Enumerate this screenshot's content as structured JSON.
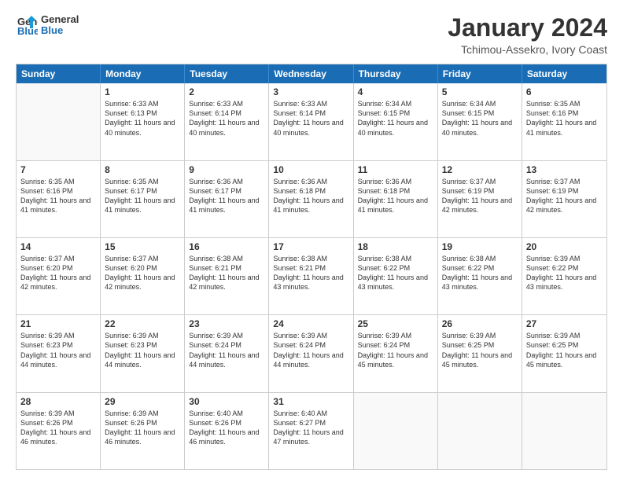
{
  "logo": {
    "line1": "General",
    "line2": "Blue"
  },
  "title": "January 2024",
  "location": "Tchimou-Assekro, Ivory Coast",
  "header_days": [
    "Sunday",
    "Monday",
    "Tuesday",
    "Wednesday",
    "Thursday",
    "Friday",
    "Saturday"
  ],
  "rows": [
    [
      {
        "day": "",
        "sunrise": "",
        "sunset": "",
        "daylight": ""
      },
      {
        "day": "1",
        "sunrise": "Sunrise: 6:33 AM",
        "sunset": "Sunset: 6:13 PM",
        "daylight": "Daylight: 11 hours and 40 minutes."
      },
      {
        "day": "2",
        "sunrise": "Sunrise: 6:33 AM",
        "sunset": "Sunset: 6:14 PM",
        "daylight": "Daylight: 11 hours and 40 minutes."
      },
      {
        "day": "3",
        "sunrise": "Sunrise: 6:33 AM",
        "sunset": "Sunset: 6:14 PM",
        "daylight": "Daylight: 11 hours and 40 minutes."
      },
      {
        "day": "4",
        "sunrise": "Sunrise: 6:34 AM",
        "sunset": "Sunset: 6:15 PM",
        "daylight": "Daylight: 11 hours and 40 minutes."
      },
      {
        "day": "5",
        "sunrise": "Sunrise: 6:34 AM",
        "sunset": "Sunset: 6:15 PM",
        "daylight": "Daylight: 11 hours and 40 minutes."
      },
      {
        "day": "6",
        "sunrise": "Sunrise: 6:35 AM",
        "sunset": "Sunset: 6:16 PM",
        "daylight": "Daylight: 11 hours and 41 minutes."
      }
    ],
    [
      {
        "day": "7",
        "sunrise": "Sunrise: 6:35 AM",
        "sunset": "Sunset: 6:16 PM",
        "daylight": "Daylight: 11 hours and 41 minutes."
      },
      {
        "day": "8",
        "sunrise": "Sunrise: 6:35 AM",
        "sunset": "Sunset: 6:17 PM",
        "daylight": "Daylight: 11 hours and 41 minutes."
      },
      {
        "day": "9",
        "sunrise": "Sunrise: 6:36 AM",
        "sunset": "Sunset: 6:17 PM",
        "daylight": "Daylight: 11 hours and 41 minutes."
      },
      {
        "day": "10",
        "sunrise": "Sunrise: 6:36 AM",
        "sunset": "Sunset: 6:18 PM",
        "daylight": "Daylight: 11 hours and 41 minutes."
      },
      {
        "day": "11",
        "sunrise": "Sunrise: 6:36 AM",
        "sunset": "Sunset: 6:18 PM",
        "daylight": "Daylight: 11 hours and 41 minutes."
      },
      {
        "day": "12",
        "sunrise": "Sunrise: 6:37 AM",
        "sunset": "Sunset: 6:19 PM",
        "daylight": "Daylight: 11 hours and 42 minutes."
      },
      {
        "day": "13",
        "sunrise": "Sunrise: 6:37 AM",
        "sunset": "Sunset: 6:19 PM",
        "daylight": "Daylight: 11 hours and 42 minutes."
      }
    ],
    [
      {
        "day": "14",
        "sunrise": "Sunrise: 6:37 AM",
        "sunset": "Sunset: 6:20 PM",
        "daylight": "Daylight: 11 hours and 42 minutes."
      },
      {
        "day": "15",
        "sunrise": "Sunrise: 6:37 AM",
        "sunset": "Sunset: 6:20 PM",
        "daylight": "Daylight: 11 hours and 42 minutes."
      },
      {
        "day": "16",
        "sunrise": "Sunrise: 6:38 AM",
        "sunset": "Sunset: 6:21 PM",
        "daylight": "Daylight: 11 hours and 42 minutes."
      },
      {
        "day": "17",
        "sunrise": "Sunrise: 6:38 AM",
        "sunset": "Sunset: 6:21 PM",
        "daylight": "Daylight: 11 hours and 43 minutes."
      },
      {
        "day": "18",
        "sunrise": "Sunrise: 6:38 AM",
        "sunset": "Sunset: 6:22 PM",
        "daylight": "Daylight: 11 hours and 43 minutes."
      },
      {
        "day": "19",
        "sunrise": "Sunrise: 6:38 AM",
        "sunset": "Sunset: 6:22 PM",
        "daylight": "Daylight: 11 hours and 43 minutes."
      },
      {
        "day": "20",
        "sunrise": "Sunrise: 6:39 AM",
        "sunset": "Sunset: 6:22 PM",
        "daylight": "Daylight: 11 hours and 43 minutes."
      }
    ],
    [
      {
        "day": "21",
        "sunrise": "Sunrise: 6:39 AM",
        "sunset": "Sunset: 6:23 PM",
        "daylight": "Daylight: 11 hours and 44 minutes."
      },
      {
        "day": "22",
        "sunrise": "Sunrise: 6:39 AM",
        "sunset": "Sunset: 6:23 PM",
        "daylight": "Daylight: 11 hours and 44 minutes."
      },
      {
        "day": "23",
        "sunrise": "Sunrise: 6:39 AM",
        "sunset": "Sunset: 6:24 PM",
        "daylight": "Daylight: 11 hours and 44 minutes."
      },
      {
        "day": "24",
        "sunrise": "Sunrise: 6:39 AM",
        "sunset": "Sunset: 6:24 PM",
        "daylight": "Daylight: 11 hours and 44 minutes."
      },
      {
        "day": "25",
        "sunrise": "Sunrise: 6:39 AM",
        "sunset": "Sunset: 6:24 PM",
        "daylight": "Daylight: 11 hours and 45 minutes."
      },
      {
        "day": "26",
        "sunrise": "Sunrise: 6:39 AM",
        "sunset": "Sunset: 6:25 PM",
        "daylight": "Daylight: 11 hours and 45 minutes."
      },
      {
        "day": "27",
        "sunrise": "Sunrise: 6:39 AM",
        "sunset": "Sunset: 6:25 PM",
        "daylight": "Daylight: 11 hours and 45 minutes."
      }
    ],
    [
      {
        "day": "28",
        "sunrise": "Sunrise: 6:39 AM",
        "sunset": "Sunset: 6:26 PM",
        "daylight": "Daylight: 11 hours and 46 minutes."
      },
      {
        "day": "29",
        "sunrise": "Sunrise: 6:39 AM",
        "sunset": "Sunset: 6:26 PM",
        "daylight": "Daylight: 11 hours and 46 minutes."
      },
      {
        "day": "30",
        "sunrise": "Sunrise: 6:40 AM",
        "sunset": "Sunset: 6:26 PM",
        "daylight": "Daylight: 11 hours and 46 minutes."
      },
      {
        "day": "31",
        "sunrise": "Sunrise: 6:40 AM",
        "sunset": "Sunset: 6:27 PM",
        "daylight": "Daylight: 11 hours and 47 minutes."
      },
      {
        "day": "",
        "sunrise": "",
        "sunset": "",
        "daylight": ""
      },
      {
        "day": "",
        "sunrise": "",
        "sunset": "",
        "daylight": ""
      },
      {
        "day": "",
        "sunrise": "",
        "sunset": "",
        "daylight": ""
      }
    ]
  ]
}
